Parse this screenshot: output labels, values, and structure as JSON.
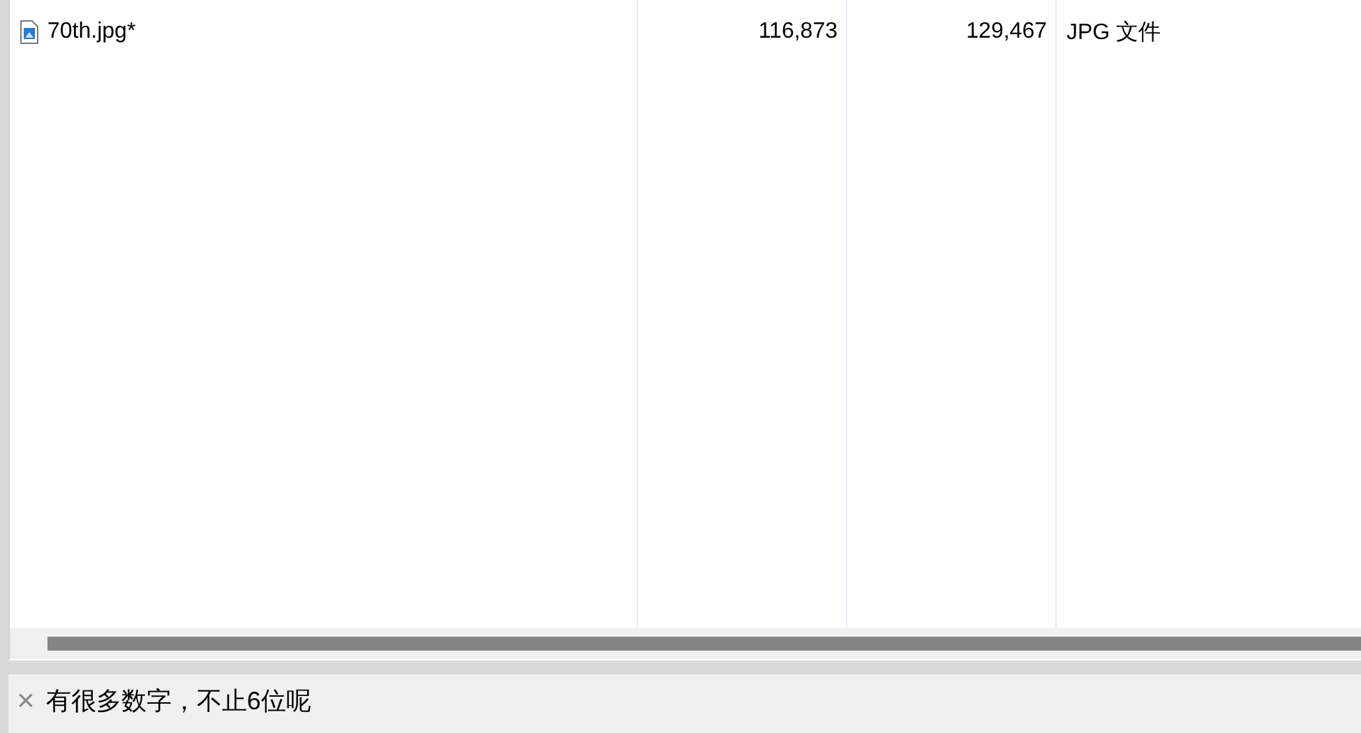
{
  "file_list": {
    "rows": [
      {
        "name": "70th.jpg*",
        "compressed_size": "116,873",
        "original_size": "129,467",
        "type": "JPG 文件"
      }
    ]
  },
  "comment_bar": {
    "close": "×",
    "text": "有很多数字，不止6位呢"
  }
}
